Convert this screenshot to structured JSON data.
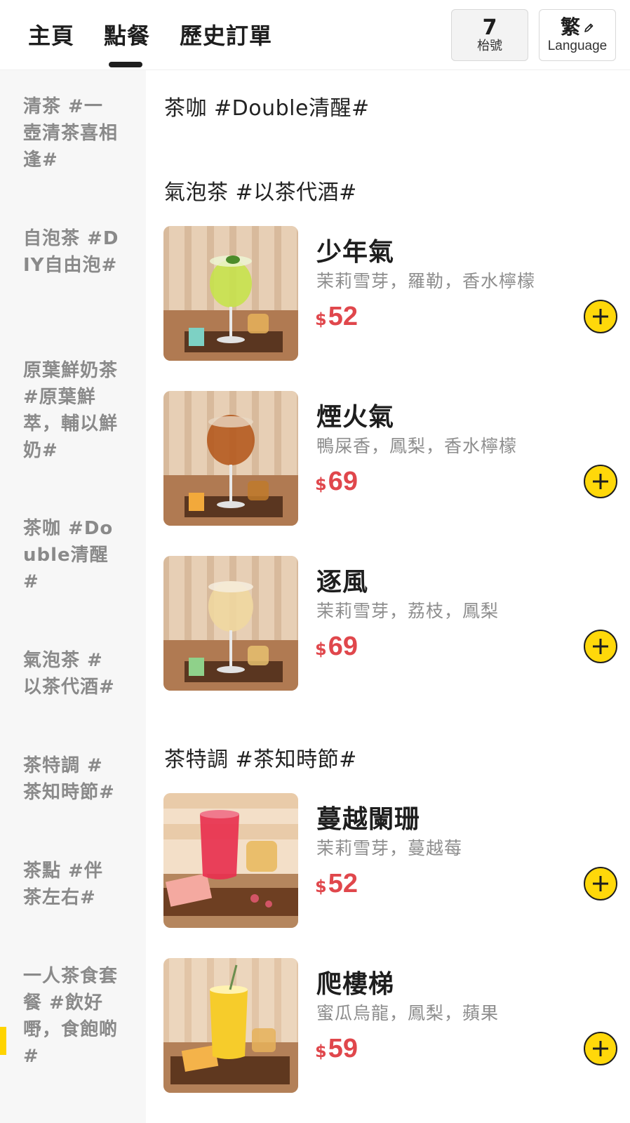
{
  "header": {
    "tabs": [
      {
        "label": "主頁"
      },
      {
        "label": "點餐"
      },
      {
        "label": "歷史訂單"
      }
    ],
    "table": {
      "number": "7",
      "label": "枱號"
    },
    "language": {
      "char": "繁",
      "label": "Language",
      "icon": "pencil-icon"
    }
  },
  "sidebar": {
    "items": [
      {
        "label": "清茶 #一壺清茶喜相逢#"
      },
      {
        "label": "自泡茶 #DIY自由泡#"
      },
      {
        "label": "原葉鮮奶茶 #原葉鮮萃，輔以鮮奶#"
      },
      {
        "label": "茶咖 #Double清醒#"
      },
      {
        "label": "氣泡茶 #以茶代酒#"
      },
      {
        "label": "茶特調 #茶知時節#"
      },
      {
        "label": "茶點 #伴茶左右#"
      },
      {
        "label": "一人茶食套餐 #飲好嘢，食飽啲#"
      }
    ],
    "accent_color": "#ffd400"
  },
  "main": {
    "sections": [
      {
        "title": "茶咖 #Double清醒#"
      },
      {
        "title": "氣泡茶 #以茶代酒#"
      },
      {
        "title": "茶特調 #茶知時節#"
      }
    ],
    "items": [
      {
        "name": "少年氣",
        "desc": "茉莉雪芽，羅勒，香水檸檬",
        "currency": "$",
        "price": "52"
      },
      {
        "name": "煙火氣",
        "desc": "鴨屎香，鳳梨，香水檸檬",
        "currency": "$",
        "price": "69"
      },
      {
        "name": "逐風",
        "desc": "茉莉雪芽，荔枝，鳳梨",
        "currency": "$",
        "price": "69"
      },
      {
        "name": "蔓越闌珊",
        "desc": "茉莉雪芽，蔓越莓",
        "currency": "$",
        "price": "52"
      },
      {
        "name": "爬樓梯",
        "desc": "蜜瓜烏龍，鳳梨，蘋果",
        "currency": "$",
        "price": "59"
      }
    ],
    "price_color": "#e0474c",
    "add_button_color": "#ffd80a"
  }
}
